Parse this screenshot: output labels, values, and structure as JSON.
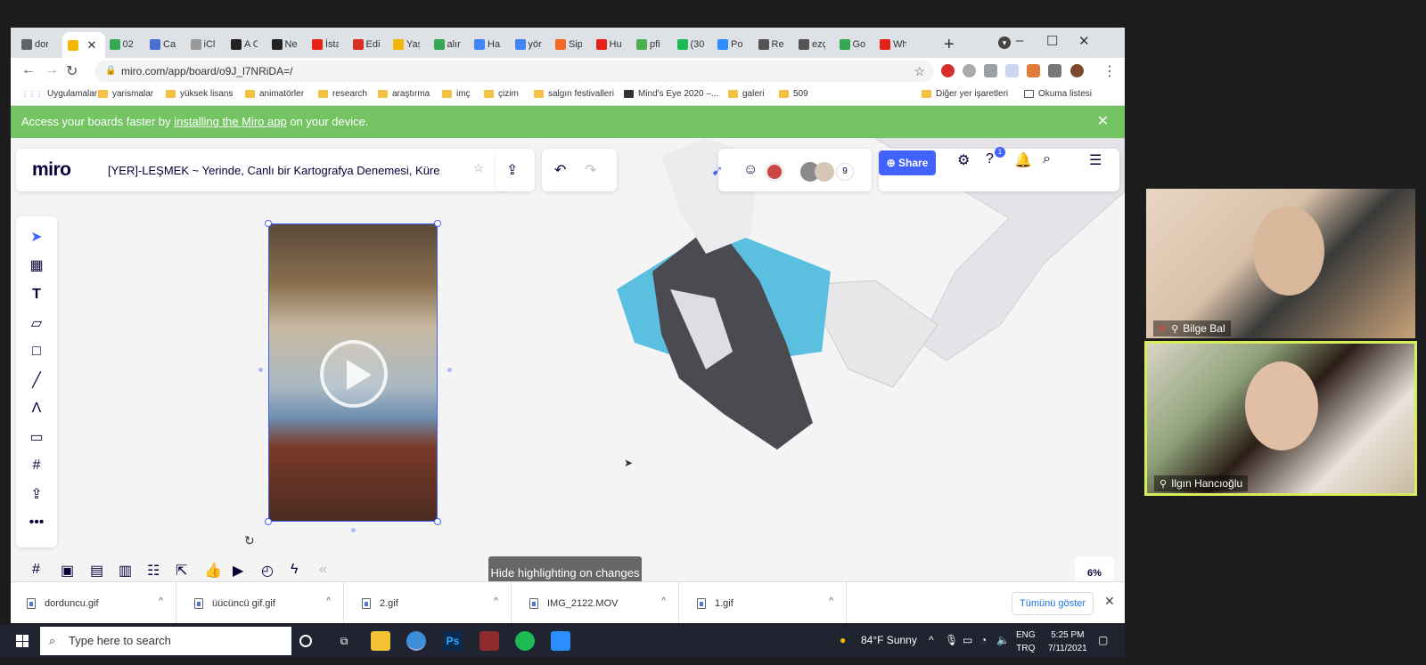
{
  "browser": {
    "tabs": [
      {
        "label": "dor",
        "color": "#5f6368"
      },
      {
        "label": "",
        "color": "#f2b705",
        "active": true
      },
      {
        "label": "02",
        "color": "#34a853"
      },
      {
        "label": "Ca",
        "color": "#4a6fd4"
      },
      {
        "label": "iCl",
        "color": "#999999"
      },
      {
        "label": "A C",
        "color": "#222222"
      },
      {
        "label": "Ne",
        "color": "#222222"
      },
      {
        "label": "İsta",
        "color": "#e62117"
      },
      {
        "label": "Edi",
        "color": "#d93025"
      },
      {
        "label": "Yaş",
        "color": "#f2b705"
      },
      {
        "label": "alın",
        "color": "#34a853"
      },
      {
        "label": "Ha",
        "color": "#4285f4"
      },
      {
        "label": "yör",
        "color": "#4285f4"
      },
      {
        "label": "Sip",
        "color": "#f06a26"
      },
      {
        "label": "Hu",
        "color": "#e62117"
      },
      {
        "label": "pfi",
        "color": "#4caf50"
      },
      {
        "label": "(30",
        "color": "#1db954"
      },
      {
        "label": "Po",
        "color": "#2d8cff"
      },
      {
        "label": "Re",
        "color": "#555555"
      },
      {
        "label": "ezç",
        "color": "#555555"
      },
      {
        "label": "Go",
        "color": "#34a853"
      },
      {
        "label": "Wh",
        "color": "#e62117"
      }
    ],
    "active_tab_close": "✕",
    "new_tab": "+",
    "url": "miro.com/app/board/o9J_l7NRiDA=/",
    "bookmarks": [
      {
        "label": "Uygulamalar",
        "type": "apps"
      },
      {
        "label": "yarismalar",
        "type": "folder"
      },
      {
        "label": "yüksek lisans",
        "type": "folder"
      },
      {
        "label": "animatörler",
        "type": "folder"
      },
      {
        "label": "research",
        "type": "folder"
      },
      {
        "label": "araştırma",
        "type": "folder"
      },
      {
        "label": "imç",
        "type": "folder"
      },
      {
        "label": "çizim",
        "type": "folder"
      },
      {
        "label": "salgın festivalleri",
        "type": "folder"
      },
      {
        "label": "Mind's Eye 2020 –...",
        "type": "page"
      },
      {
        "label": "galeri",
        "type": "folder"
      },
      {
        "label": "509",
        "type": "folder"
      }
    ],
    "bookmarks_right": [
      {
        "label": "Diğer yer işaretleri"
      },
      {
        "label": "Okuma listesi"
      }
    ]
  },
  "banner": {
    "prefix": "Access your boards faster by ",
    "link": "installing the Miro app",
    "suffix": " on your device."
  },
  "miro": {
    "logo": "miro",
    "board_title": "[YER]-LEŞMEK ~ Yerinde, Canlı bir Kartografya Denemesi, Küre",
    "share_label": "Share",
    "collaborator_count": "9",
    "help_badge": "1",
    "hide_highlighting": "Hide highlighting on changes",
    "zoom_level": "6%"
  },
  "downloads": {
    "items": [
      {
        "name": "dorduncu.gif"
      },
      {
        "name": "üücüncü gif.gif"
      },
      {
        "name": "2.gif"
      },
      {
        "name": "IMG_2122.MOV"
      },
      {
        "name": "1.gif"
      }
    ],
    "show_all": "Tümünü göster"
  },
  "zoom": {
    "participants": [
      {
        "name": "Bilge Bal",
        "muted": true
      },
      {
        "name": "Ilgın Hancıoğlu",
        "muted": false
      }
    ]
  },
  "taskbar": {
    "search_placeholder": "Type here to search",
    "weather": "84°F  Sunny",
    "language": "ENG",
    "keyboard": "TRQ",
    "time": "5:25 PM",
    "date": "7/11/2021"
  }
}
